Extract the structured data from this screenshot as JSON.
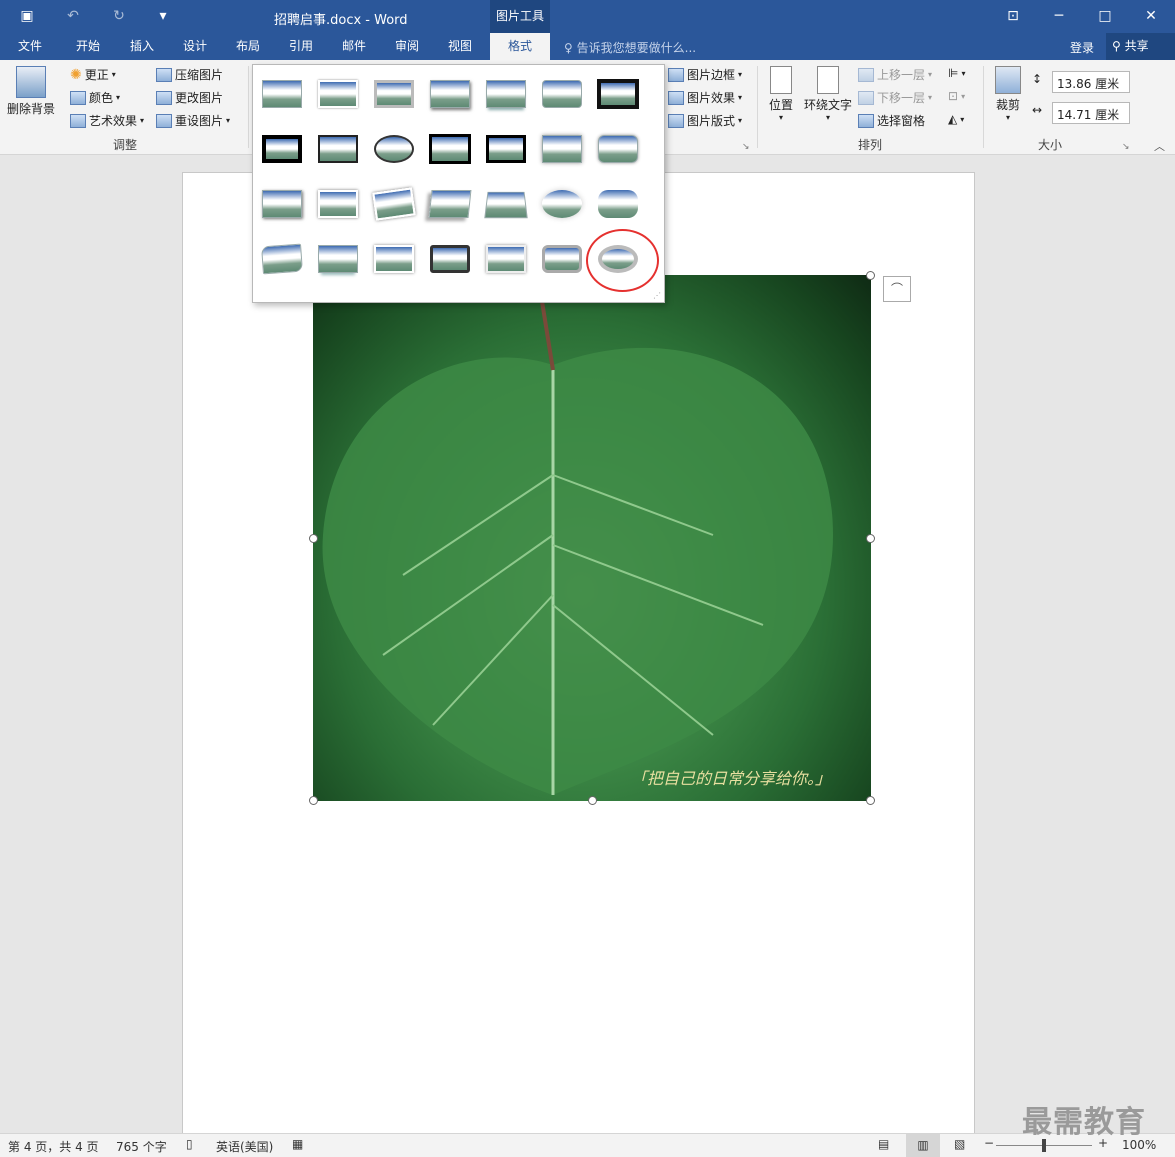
{
  "window": {
    "title": "招聘启事.docx - Word",
    "context_tab_group": "图片工具"
  },
  "tabs": [
    "文件",
    "开始",
    "插入",
    "设计",
    "布局",
    "引用",
    "邮件",
    "审阅",
    "视图",
    "格式"
  ],
  "active_tab": "格式",
  "tell_me": "告诉我您想要做什么...",
  "account": {
    "login": "登录",
    "share": "共享"
  },
  "ribbon": {
    "remove_bg": "删除背景",
    "corrections": "更正",
    "color": "颜色",
    "art_effects": "艺术效果",
    "compress": "压缩图片",
    "change_picture": "更改图片",
    "reset_picture": "重设图片",
    "adjust_group": "调整",
    "picture_border": "图片边框",
    "picture_effects": "图片效果",
    "picture_layout": "图片版式",
    "position": "位置",
    "wrap_text": "环绕文字",
    "bring_forward": "上移一层",
    "send_backward": "下移一层",
    "selection_pane": "选择窗格",
    "arrange_group": "排列",
    "crop": "裁剪",
    "height": "13.86 厘米",
    "width": "14.71 厘米",
    "size_group": "大小"
  },
  "picture_caption": "「把自己的日常分享给你。」",
  "status": {
    "page": "第 4 页，共 4 页",
    "words": "765 个字",
    "language": "英语(美国)",
    "zoom": "100%"
  },
  "watermark": "最需教育",
  "colors": {
    "word_blue": "#2b579a",
    "highlight_red": "#e5312f"
  }
}
